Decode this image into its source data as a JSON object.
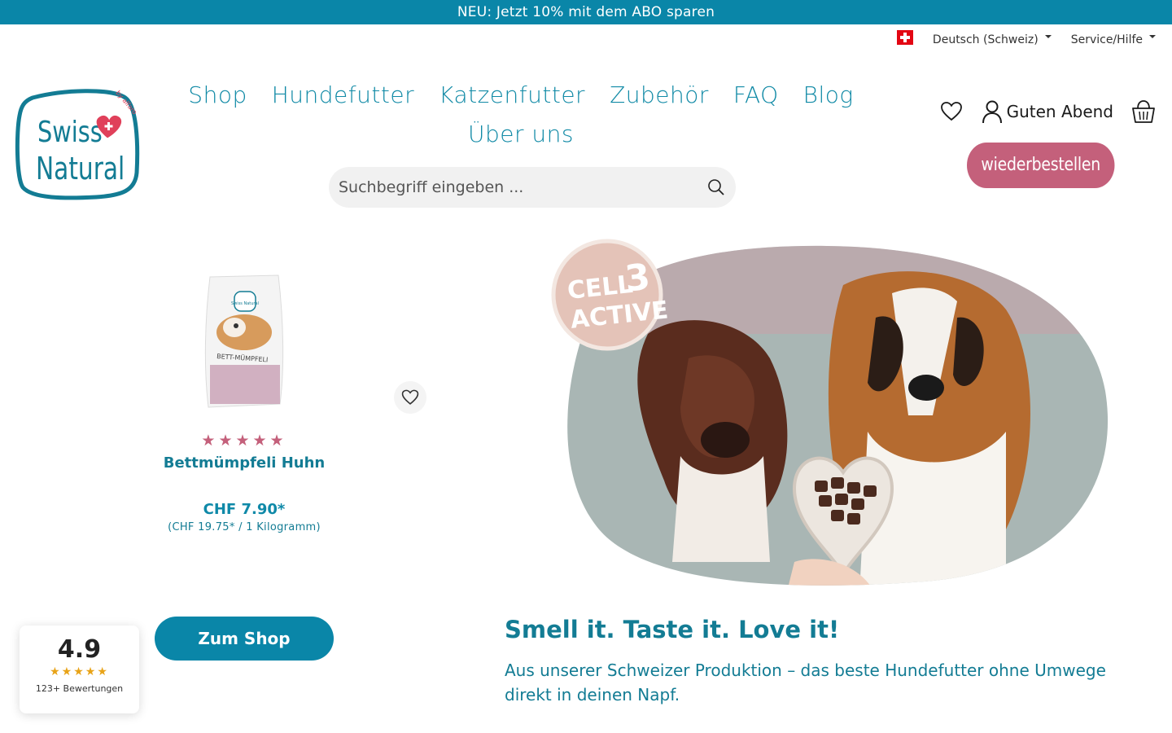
{
  "announcement": "NEU: Jetzt 10% mit dem ABO sparen",
  "utility": {
    "flag_icon": "swiss-flag-icon",
    "language": "Deutsch (Schweiz)",
    "service": "Service/Hilfe"
  },
  "logo": {
    "line1": "Swiss",
    "line2": "Natural",
    "tag": "by alfaro"
  },
  "nav": {
    "items": [
      "Shop",
      "Hundefutter",
      "Katzenfutter",
      "Zubehör",
      "FAQ",
      "Blog",
      "Über uns"
    ]
  },
  "search": {
    "placeholder": "Suchbegriff eingeben ..."
  },
  "account": {
    "greeting": "Guten Abend"
  },
  "reorder_label": "wiederbestellen",
  "product": {
    "pack_brand": "Swiss Natural",
    "pack_name": "BETT-MÜMPFELI",
    "rating_stars": 5,
    "name": "Bettmümpfeli Huhn",
    "price": "CHF 7.90*",
    "unit_price": "(CHF 19.75* / 1 Kilogramm)"
  },
  "shop_button": "Zum Shop",
  "rating": {
    "score": "4.9",
    "stars": "★★★★★",
    "count": "123+ Bewertungen"
  },
  "hero": {
    "badge_line1": "CELL",
    "badge_digit": "3",
    "badge_line2": "ACTIVE",
    "headline": "Smell it. Taste it. Love it!",
    "subline": "Aus unserer Schweizer Produktion – das beste Hundefutter ohne Umwege direkt in deinen Napf."
  },
  "colors": {
    "brand_blue": "#0a86a8",
    "brand_teal": "#137c94",
    "accent_pink": "#c4607b",
    "star_gold": "#e8a317"
  }
}
